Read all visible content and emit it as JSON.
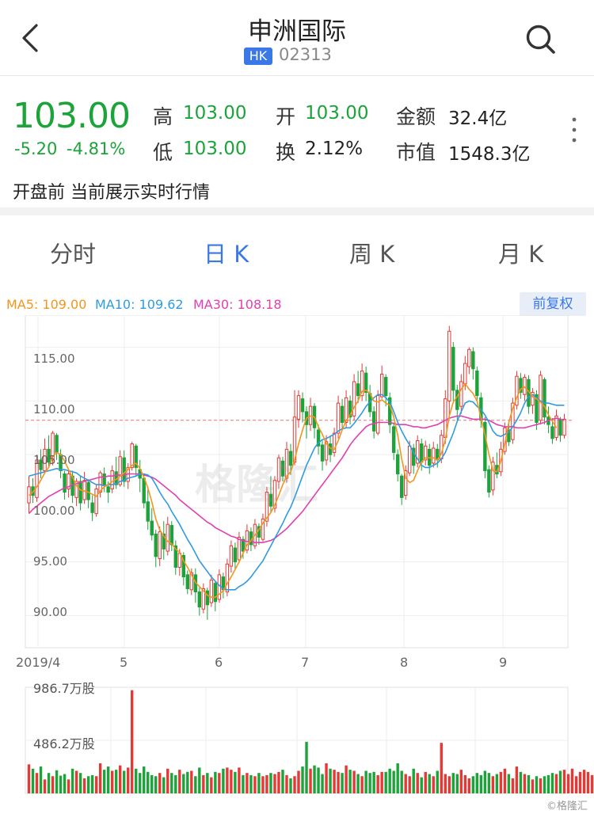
{
  "header": {
    "title": "申洲国际",
    "market_badge": "HK",
    "stock_code": "02313",
    "icons": {
      "back": "chevron-left-icon",
      "search": "search-icon",
      "more": "more-vertical-icon"
    }
  },
  "quote": {
    "price": "103.00",
    "change": "-5.20",
    "change_pct": "-4.81%",
    "high_label": "高",
    "high": "103.00",
    "open_label": "开",
    "open": "103.00",
    "amount_label": "金额",
    "amount": "32.4亿",
    "low_label": "低",
    "low": "103.00",
    "turnover_label": "换",
    "turnover": "2.12%",
    "mktcap_label": "市值",
    "mktcap": "1548.3亿",
    "status": "开盘前 当前展示实时行情"
  },
  "tabs": [
    {
      "label": "分时",
      "active": false
    },
    {
      "label": "日 K",
      "active": true
    },
    {
      "label": "周 K",
      "active": false
    },
    {
      "label": "月 K",
      "active": false
    }
  ],
  "indicators": {
    "ma5": "MA5: 109.00",
    "ma10": "MA10: 109.62",
    "ma30": "MA30: 108.18",
    "adjust_button": "前复权"
  },
  "colors": {
    "up": "#e53935",
    "down": "#1ca33a",
    "ma5": "#f0961e",
    "ma10": "#2f9be0",
    "ma30": "#e040b0",
    "accent": "#3b78e7"
  },
  "watermark": "格隆汇",
  "credit": "©格隆汇",
  "chart_data": {
    "type": "candlestick",
    "x_axis_labels": [
      "2019/4",
      "5",
      "6",
      "7",
      "8",
      "9"
    ],
    "y_ticks": [
      "115.00",
      "110.00",
      "105.00",
      "100.00",
      "95.00",
      "90.00"
    ],
    "ylim": [
      87,
      118
    ],
    "reference_price": 108.2,
    "volume_ticks": [
      "986.7万股",
      "486.2万股"
    ],
    "volume_max": 986.7,
    "candles": [
      [
        100.5,
        102.0,
        99.5,
        103.0
      ],
      [
        102.0,
        101.2,
        100.5,
        102.8
      ],
      [
        101.0,
        104.5,
        100.6,
        105.0
      ],
      [
        104.5,
        103.6,
        102.8,
        105.5
      ],
      [
        103.5,
        105.5,
        103.2,
        106.5
      ],
      [
        105.5,
        104.3,
        103.8,
        106.8
      ],
      [
        104.5,
        107.0,
        104.0,
        107.2
      ],
      [
        106.8,
        105.2,
        104.5,
        107.0
      ],
      [
        105.0,
        103.5,
        102.8,
        105.5
      ],
      [
        103.2,
        101.5,
        100.8,
        103.5
      ],
      [
        101.8,
        103.2,
        101.0,
        103.5
      ],
      [
        103.0,
        101.2,
        100.5,
        103.5
      ],
      [
        101.0,
        102.5,
        100.2,
        102.8
      ],
      [
        102.5,
        100.5,
        99.8,
        103.0
      ],
      [
        100.8,
        102.6,
        100.4,
        103.4
      ],
      [
        102.4,
        100.8,
        100.0,
        102.7
      ],
      [
        100.5,
        99.6,
        98.8,
        101.2
      ],
      [
        99.5,
        101.8,
        99.2,
        102.2
      ],
      [
        101.5,
        103.3,
        101.0,
        103.5
      ],
      [
        103.2,
        102.2,
        101.5,
        103.8
      ],
      [
        102.0,
        101.5,
        100.5,
        102.5
      ],
      [
        101.8,
        103.5,
        101.4,
        104.0
      ],
      [
        103.4,
        102.2,
        101.8,
        104.8
      ],
      [
        102.2,
        104.8,
        102.0,
        105.4
      ],
      [
        104.7,
        102.5,
        102.0,
        105.4
      ],
      [
        102.5,
        103.8,
        101.8,
        104.2
      ],
      [
        103.8,
        106.0,
        103.5,
        106.2
      ],
      [
        105.8,
        103.8,
        103.0,
        106.0
      ],
      [
        103.6,
        102.8,
        101.5,
        104.5
      ],
      [
        102.8,
        100.5,
        100.0,
        103.2
      ],
      [
        100.6,
        98.8,
        98.0,
        102.0
      ],
      [
        98.8,
        97.5,
        97.0,
        100.0
      ],
      [
        97.6,
        95.5,
        94.5,
        98.0
      ],
      [
        95.3,
        97.8,
        94.6,
        98.3
      ],
      [
        97.6,
        96.2,
        95.2,
        98.8
      ],
      [
        96.0,
        98.5,
        95.6,
        99.2
      ],
      [
        98.4,
        96.6,
        96.0,
        98.8
      ],
      [
        96.5,
        94.5,
        93.8,
        97.0
      ],
      [
        94.5,
        95.8,
        93.7,
        96.2
      ],
      [
        95.6,
        93.6,
        92.8,
        95.9
      ],
      [
        93.8,
        92.5,
        92.0,
        94.2
      ],
      [
        92.4,
        94.0,
        91.9,
        94.4
      ],
      [
        93.8,
        92.2,
        91.2,
        94.4
      ],
      [
        92.2,
        90.8,
        90.0,
        92.6
      ],
      [
        90.6,
        92.5,
        90.2,
        93.0
      ],
      [
        92.3,
        91.0,
        89.6,
        92.6
      ],
      [
        91.2,
        93.3,
        90.8,
        93.8
      ],
      [
        93.0,
        91.3,
        90.4,
        93.2
      ],
      [
        91.5,
        93.8,
        91.2,
        94.3
      ],
      [
        93.6,
        92.4,
        91.6,
        94.0
      ],
      [
        92.2,
        94.8,
        91.8,
        95.3
      ],
      [
        94.6,
        96.5,
        94.0,
        97.0
      ],
      [
        96.3,
        95.0,
        94.3,
        96.8
      ],
      [
        95.2,
        97.3,
        94.9,
        97.8
      ],
      [
        97.1,
        96.0,
        95.3,
        97.4
      ],
      [
        96.1,
        97.9,
        95.8,
        98.5
      ],
      [
        97.8,
        96.6,
        96.0,
        98.2
      ],
      [
        96.5,
        98.5,
        96.2,
        99.0
      ],
      [
        98.3,
        97.3,
        96.6,
        98.6
      ],
      [
        97.1,
        99.0,
        96.9,
        99.5
      ],
      [
        98.8,
        101.5,
        98.3,
        102.0
      ],
      [
        101.3,
        100.2,
        99.6,
        103.0
      ],
      [
        100.0,
        102.6,
        99.6,
        103.0
      ],
      [
        102.5,
        104.7,
        101.8,
        105.0
      ],
      [
        104.4,
        103.0,
        102.5,
        104.8
      ],
      [
        102.8,
        105.5,
        102.4,
        106.2
      ],
      [
        105.3,
        104.0,
        103.1,
        106.0
      ],
      [
        104.3,
        108.5,
        104.0,
        111.0
      ],
      [
        108.3,
        110.5,
        107.5,
        111.0
      ],
      [
        110.2,
        109.0,
        108.0,
        110.8
      ],
      [
        109.0,
        107.8,
        106.5,
        109.5
      ],
      [
        107.8,
        109.5,
        107.2,
        110.3
      ],
      [
        109.5,
        107.5,
        106.5,
        109.8
      ],
      [
        107.3,
        105.8,
        105.0,
        107.8
      ],
      [
        105.9,
        104.4,
        103.5,
        106.3
      ],
      [
        104.5,
        106.2,
        104.0,
        106.8
      ],
      [
        106.0,
        105.0,
        104.3,
        106.8
      ],
      [
        105.2,
        107.0,
        104.8,
        107.5
      ],
      [
        107.0,
        109.8,
        106.5,
        110.5
      ],
      [
        109.5,
        108.0,
        107.3,
        110.2
      ],
      [
        108.0,
        110.3,
        107.5,
        111.0
      ],
      [
        110.0,
        108.5,
        107.8,
        110.5
      ],
      [
        108.6,
        111.8,
        108.2,
        112.5
      ],
      [
        111.6,
        110.5,
        109.8,
        112.8
      ],
      [
        110.5,
        112.8,
        110.0,
        113.5
      ],
      [
        112.6,
        110.8,
        110.0,
        113.2
      ],
      [
        110.7,
        109.0,
        108.5,
        111.5
      ],
      [
        109.0,
        107.2,
        106.5,
        109.5
      ],
      [
        107.0,
        110.5,
        106.8,
        111.0
      ],
      [
        110.4,
        112.5,
        110.2,
        113.3
      ],
      [
        112.2,
        110.5,
        109.5,
        112.5
      ],
      [
        110.3,
        107.8,
        107.0,
        110.8
      ],
      [
        107.6,
        105.2,
        104.5,
        108.0
      ],
      [
        105.0,
        103.2,
        102.5,
        105.5
      ],
      [
        103.0,
        101.0,
        100.3,
        103.2
      ],
      [
        101.2,
        103.5,
        100.8,
        104.0
      ],
      [
        103.3,
        105.8,
        103.0,
        106.3
      ],
      [
        105.6,
        104.0,
        103.2,
        106.0
      ],
      [
        104.2,
        106.3,
        103.8,
        106.8
      ],
      [
        106.0,
        104.3,
        103.5,
        106.5
      ],
      [
        104.5,
        105.8,
        104.0,
        106.3
      ],
      [
        105.5,
        104.0,
        103.2,
        106.0
      ],
      [
        104.2,
        105.6,
        103.8,
        106.2
      ],
      [
        105.5,
        104.5,
        103.8,
        106.0
      ],
      [
        104.6,
        106.8,
        104.2,
        107.3
      ],
      [
        106.6,
        110.2,
        106.0,
        111.0
      ],
      [
        110.0,
        116.5,
        108.5,
        117.0
      ],
      [
        115.0,
        111.0,
        110.0,
        115.5
      ],
      [
        111.0,
        109.2,
        108.2,
        111.5
      ],
      [
        109.5,
        111.8,
        108.8,
        112.5
      ],
      [
        111.6,
        113.5,
        111.0,
        114.2
      ],
      [
        113.2,
        114.8,
        112.5,
        115.0
      ],
      [
        114.6,
        113.0,
        112.0,
        115.0
      ],
      [
        112.8,
        110.5,
        110.0,
        113.2
      ],
      [
        110.3,
        108.2,
        107.5,
        110.8
      ],
      [
        108.0,
        103.5,
        102.8,
        108.5
      ],
      [
        103.6,
        101.5,
        101.0,
        104.0
      ],
      [
        101.7,
        104.3,
        101.2,
        104.8
      ],
      [
        104.0,
        103.2,
        102.8,
        105.2
      ],
      [
        103.4,
        105.5,
        103.0,
        106.2
      ],
      [
        105.3,
        107.5,
        105.0,
        108.0
      ],
      [
        107.3,
        106.2,
        105.8,
        108.0
      ],
      [
        106.4,
        109.8,
        106.0,
        110.3
      ],
      [
        109.6,
        112.3,
        109.2,
        112.8
      ],
      [
        112.1,
        110.8,
        110.2,
        112.6
      ],
      [
        110.6,
        112.2,
        110.0,
        112.5
      ],
      [
        112.0,
        109.5,
        108.8,
        112.4
      ],
      [
        109.6,
        110.8,
        108.8,
        111.2
      ],
      [
        110.6,
        108.0,
        107.3,
        111.0
      ],
      [
        108.2,
        112.4,
        107.8,
        112.8
      ],
      [
        112.0,
        108.5,
        107.8,
        112.2
      ],
      [
        108.5,
        107.8,
        107.0,
        109.5
      ],
      [
        107.6,
        106.5,
        106.0,
        108.4
      ],
      [
        106.6,
        108.6,
        106.3,
        109.2
      ],
      [
        108.3,
        106.8,
        106.2,
        108.5
      ],
      [
        106.8,
        108.3,
        106.5,
        108.8
      ]
    ],
    "ma5": [
      101.2,
      101.5,
      102.0,
      102.6,
      103.3,
      103.8,
      104.8,
      105.2,
      105.0,
      104.4,
      103.6,
      102.9,
      102.1,
      101.7,
      101.6,
      101.5,
      101.3,
      101.1,
      101.6,
      102.0,
      102.2,
      102.5,
      102.7,
      103.0,
      103.3,
      103.6,
      104.0,
      104.2,
      103.7,
      102.9,
      101.9,
      100.6,
      99.0,
      98.0,
      97.4,
      96.9,
      96.7,
      96.2,
      95.9,
      95.1,
      94.5,
      93.8,
      93.1,
      92.7,
      92.3,
      91.9,
      91.7,
      91.7,
      92.0,
      92.3,
      93.0,
      93.6,
      94.3,
      95.0,
      95.8,
      96.6,
      97.0,
      97.5,
      98.0,
      98.6,
      99.1,
      99.6,
      100.3,
      101.2,
      102.2,
      103.0,
      103.4,
      104.5,
      106.0,
      107.3,
      108.4,
      108.6,
      108.5,
      107.6,
      106.9,
      106.0,
      105.6,
      105.5,
      106.3,
      107.3,
      108.2,
      108.7,
      109.4,
      110.0,
      110.9,
      111.0,
      110.7,
      110.0,
      109.9,
      110.1,
      109.8,
      109.6,
      108.5,
      106.8,
      104.6,
      102.8,
      102.4,
      102.6,
      103.5,
      104.3,
      104.7,
      104.7,
      104.7,
      104.5,
      105.1,
      106.4,
      108.6,
      109.9,
      110.4,
      111.1,
      111.6,
      111.1,
      110.7,
      110.0,
      108.4,
      106.9,
      105.0,
      103.5,
      103.4,
      104.4,
      106.0,
      108.0,
      109.3,
      110.3,
      111.1,
      111.3,
      110.9,
      110.4,
      110.2,
      109.9,
      109.5,
      108.7,
      108.1,
      107.5
    ],
    "ma10": [
      103.0,
      103.1,
      103.2,
      103.3,
      103.4,
      103.5,
      103.6,
      103.7,
      103.6,
      103.6,
      103.5,
      103.4,
      103.3,
      103.0,
      102.8,
      102.6,
      102.4,
      102.2,
      102.2,
      102.1,
      102.2,
      102.2,
      102.3,
      102.5,
      102.6,
      102.8,
      102.9,
      103.0,
      103.2,
      103.2,
      103.1,
      102.8,
      102.2,
      101.5,
      100.9,
      100.4,
      99.7,
      99.1,
      98.5,
      97.8,
      97.1,
      96.5,
      95.8,
      95.1,
      94.6,
      94.1,
      93.6,
      93.2,
      92.8,
      92.5,
      92.4,
      92.4,
      92.4,
      92.7,
      92.9,
      93.2,
      93.6,
      94.1,
      94.6,
      95.1,
      95.8,
      96.5,
      97.2,
      97.9,
      98.6,
      99.4,
      100.1,
      101.0,
      102.0,
      103.0,
      104.0,
      104.8,
      105.6,
      106.1,
      106.4,
      106.5,
      106.7,
      106.9,
      107.2,
      107.4,
      107.5,
      107.5,
      107.9,
      108.4,
      108.9,
      109.5,
      109.9,
      110.3,
      110.6,
      110.6,
      110.3,
      109.9,
      109.0,
      108.0,
      107.2,
      106.5,
      105.9,
      105.2,
      104.6,
      104.0,
      103.8,
      103.8,
      104.0,
      104.2,
      104.6,
      105.2,
      106.1,
      107.0,
      108.1,
      109.0,
      109.8,
      110.0,
      109.9,
      109.5,
      109.2,
      108.7,
      108.0,
      107.2,
      106.8,
      106.7,
      106.9,
      107.1,
      107.6,
      108.2,
      108.9,
      109.8,
      110.4,
      110.6,
      110.3,
      110.0,
      109.8,
      109.8,
      109.7,
      109.6,
      109.6,
      109.6
    ],
    "ma30": [
      99.5,
      99.9,
      100.2,
      100.5,
      100.8,
      101.1,
      101.3,
      101.5,
      101.7,
      101.9,
      102.0,
      102.2,
      102.3,
      102.4,
      102.5,
      102.6,
      102.7,
      102.8,
      102.9,
      102.9,
      103.0,
      103.0,
      103.1,
      103.1,
      103.1,
      103.2,
      103.2,
      103.2,
      103.2,
      103.1,
      103.0,
      102.9,
      102.7,
      102.4,
      102.1,
      101.8,
      101.5,
      101.2,
      100.8,
      100.5,
      100.2,
      99.9,
      99.6,
      99.3,
      99.0,
      98.7,
      98.5,
      98.2,
      98.0,
      97.8,
      97.6,
      97.4,
      97.3,
      97.1,
      97.0,
      96.9,
      96.9,
      96.8,
      96.8,
      96.8,
      96.9,
      97.0,
      97.2,
      97.5,
      97.8,
      98.1,
      98.5,
      98.9,
      99.3,
      99.7,
      100.2,
      100.7,
      101.2,
      101.7,
      102.2,
      102.7,
      103.2,
      103.7,
      104.2,
      104.7,
      105.3,
      105.9,
      106.4,
      106.8,
      107.2,
      107.6,
      107.8,
      107.9,
      108.0,
      108.0,
      108.0,
      108.0,
      107.9,
      107.8,
      107.8,
      107.8,
      107.7,
      107.6,
      107.6,
      107.5,
      107.5,
      107.6,
      107.7,
      107.8,
      108.0,
      108.2,
      108.4,
      108.5,
      108.6,
      108.6,
      108.5,
      108.4,
      108.3,
      108.3,
      108.3,
      108.3,
      108.2,
      108.0,
      107.8,
      107.7,
      107.6,
      107.6,
      107.6,
      107.5,
      107.5,
      107.5,
      107.6,
      107.7,
      107.8,
      107.9,
      108.0,
      108.2,
      108.3,
      108.4,
      108.3,
      108.2
    ],
    "volumes": [
      270,
      230,
      190,
      250,
      130,
      190,
      160,
      215,
      165,
      180,
      130,
      230,
      210,
      190,
      140,
      160,
      170,
      160,
      280,
      220,
      250,
      210,
      220,
      260,
      210,
      240,
      960,
      230,
      190,
      250,
      200,
      170,
      160,
      190,
      150,
      230,
      190,
      170,
      220,
      180,
      200,
      210,
      160,
      240,
      170,
      190,
      150,
      200,
      190,
      230,
      240,
      220,
      200,
      240,
      170,
      190,
      170,
      160,
      190,
      160,
      170,
      190,
      180,
      200,
      220,
      170,
      140,
      160,
      210,
      250,
      480,
      230,
      260,
      240,
      180,
      280,
      230,
      220,
      200,
      190,
      260,
      220,
      210,
      180,
      160,
      210,
      190,
      200,
      170,
      200,
      200,
      230,
      210,
      280,
      210,
      180,
      160,
      230,
      190,
      150,
      200,
      180,
      160,
      210,
      470,
      180,
      160,
      190,
      180,
      220,
      170,
      140,
      160,
      190,
      170,
      210,
      190,
      160,
      180,
      200,
      230,
      180,
      140,
      250,
      200,
      180,
      170,
      130,
      160,
      140,
      160,
      170,
      190,
      180,
      210,
      220,
      180,
      230,
      160,
      200,
      220,
      200,
      170,
      160
    ]
  }
}
